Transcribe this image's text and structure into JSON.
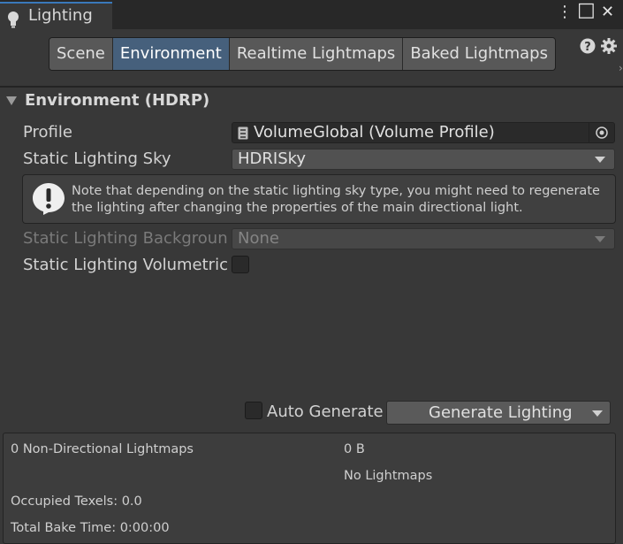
{
  "window": {
    "title": "Lighting",
    "title_icon": "lightbulb-icon",
    "controls": {
      "menu": "⋮",
      "maximize": "□",
      "close": "✕"
    }
  },
  "toolbar": {
    "tabs": [
      {
        "label": "Scene",
        "active": false
      },
      {
        "label": "Environment",
        "active": true
      },
      {
        "label": "Realtime Lightmaps",
        "active": false
      },
      {
        "label": "Baked Lightmaps",
        "active": false
      }
    ],
    "icons": [
      "help-icon",
      "gear-icon"
    ]
  },
  "section": {
    "title": "Environment (HDRP)",
    "expanded": true
  },
  "fields": {
    "profile": {
      "label": "Profile",
      "value": "VolumeGlobal (Volume Profile)"
    },
    "static_sky": {
      "label": "Static Lighting Sky",
      "value": "HDRISky"
    },
    "note": "Note that depending on the static lighting sky type, you might need to regenerate the lighting after changing the properties of the main directional light.",
    "static_background": {
      "label": "Static Lighting Background Clouds",
      "value": "None",
      "disabled": true
    },
    "static_volumetric": {
      "label": "Static Lighting Volumetric Clouds",
      "checked": false
    }
  },
  "generate": {
    "auto_label": "Auto Generate",
    "auto_checked": false,
    "button_label": "Generate Lighting"
  },
  "stats": {
    "lightmaps": "0 Non-Directional Lightmaps",
    "size": "0 B",
    "no_lightmaps": "No Lightmaps",
    "occupied": "Occupied Texels: 0.0",
    "bake_time": "Total Bake Time: 0:00:00"
  },
  "colors": {
    "background": "#383838",
    "accent": "#3a79bb",
    "active_tab": "#46607c"
  }
}
